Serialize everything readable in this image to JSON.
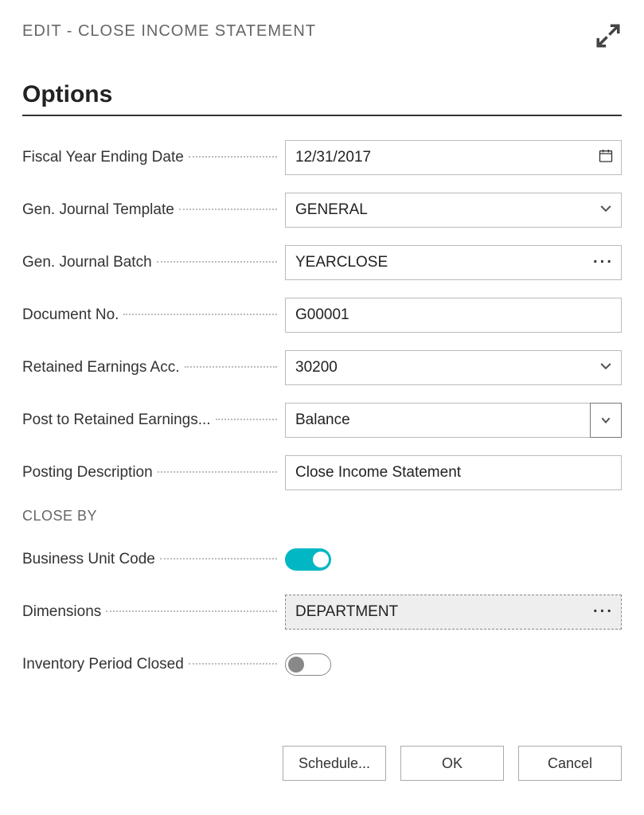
{
  "header": {
    "title": "EDIT - CLOSE INCOME STATEMENT"
  },
  "section_title": "Options",
  "close_by_label": "CLOSE BY",
  "fields": {
    "fiscal_year_ending_date": {
      "label": "Fiscal Year Ending Date",
      "value": "12/31/2017"
    },
    "gen_journal_template": {
      "label": "Gen. Journal Template",
      "value": "GENERAL"
    },
    "gen_journal_batch": {
      "label": "Gen. Journal Batch",
      "value": "YEARCLOSE"
    },
    "document_no": {
      "label": "Document No.",
      "value": "G00001"
    },
    "retained_earnings_acc": {
      "label": "Retained Earnings Acc.",
      "value": "30200"
    },
    "post_to_retained": {
      "label": "Post to Retained Earnings...",
      "value": "Balance"
    },
    "posting_description": {
      "label": "Posting Description",
      "value": "Close Income Statement"
    },
    "business_unit_code": {
      "label": "Business Unit Code",
      "on": true
    },
    "dimensions": {
      "label": "Dimensions",
      "value": "DEPARTMENT"
    },
    "inventory_period_closed": {
      "label": "Inventory Period Closed",
      "on": false
    }
  },
  "buttons": {
    "schedule": "Schedule...",
    "ok": "OK",
    "cancel": "Cancel"
  }
}
